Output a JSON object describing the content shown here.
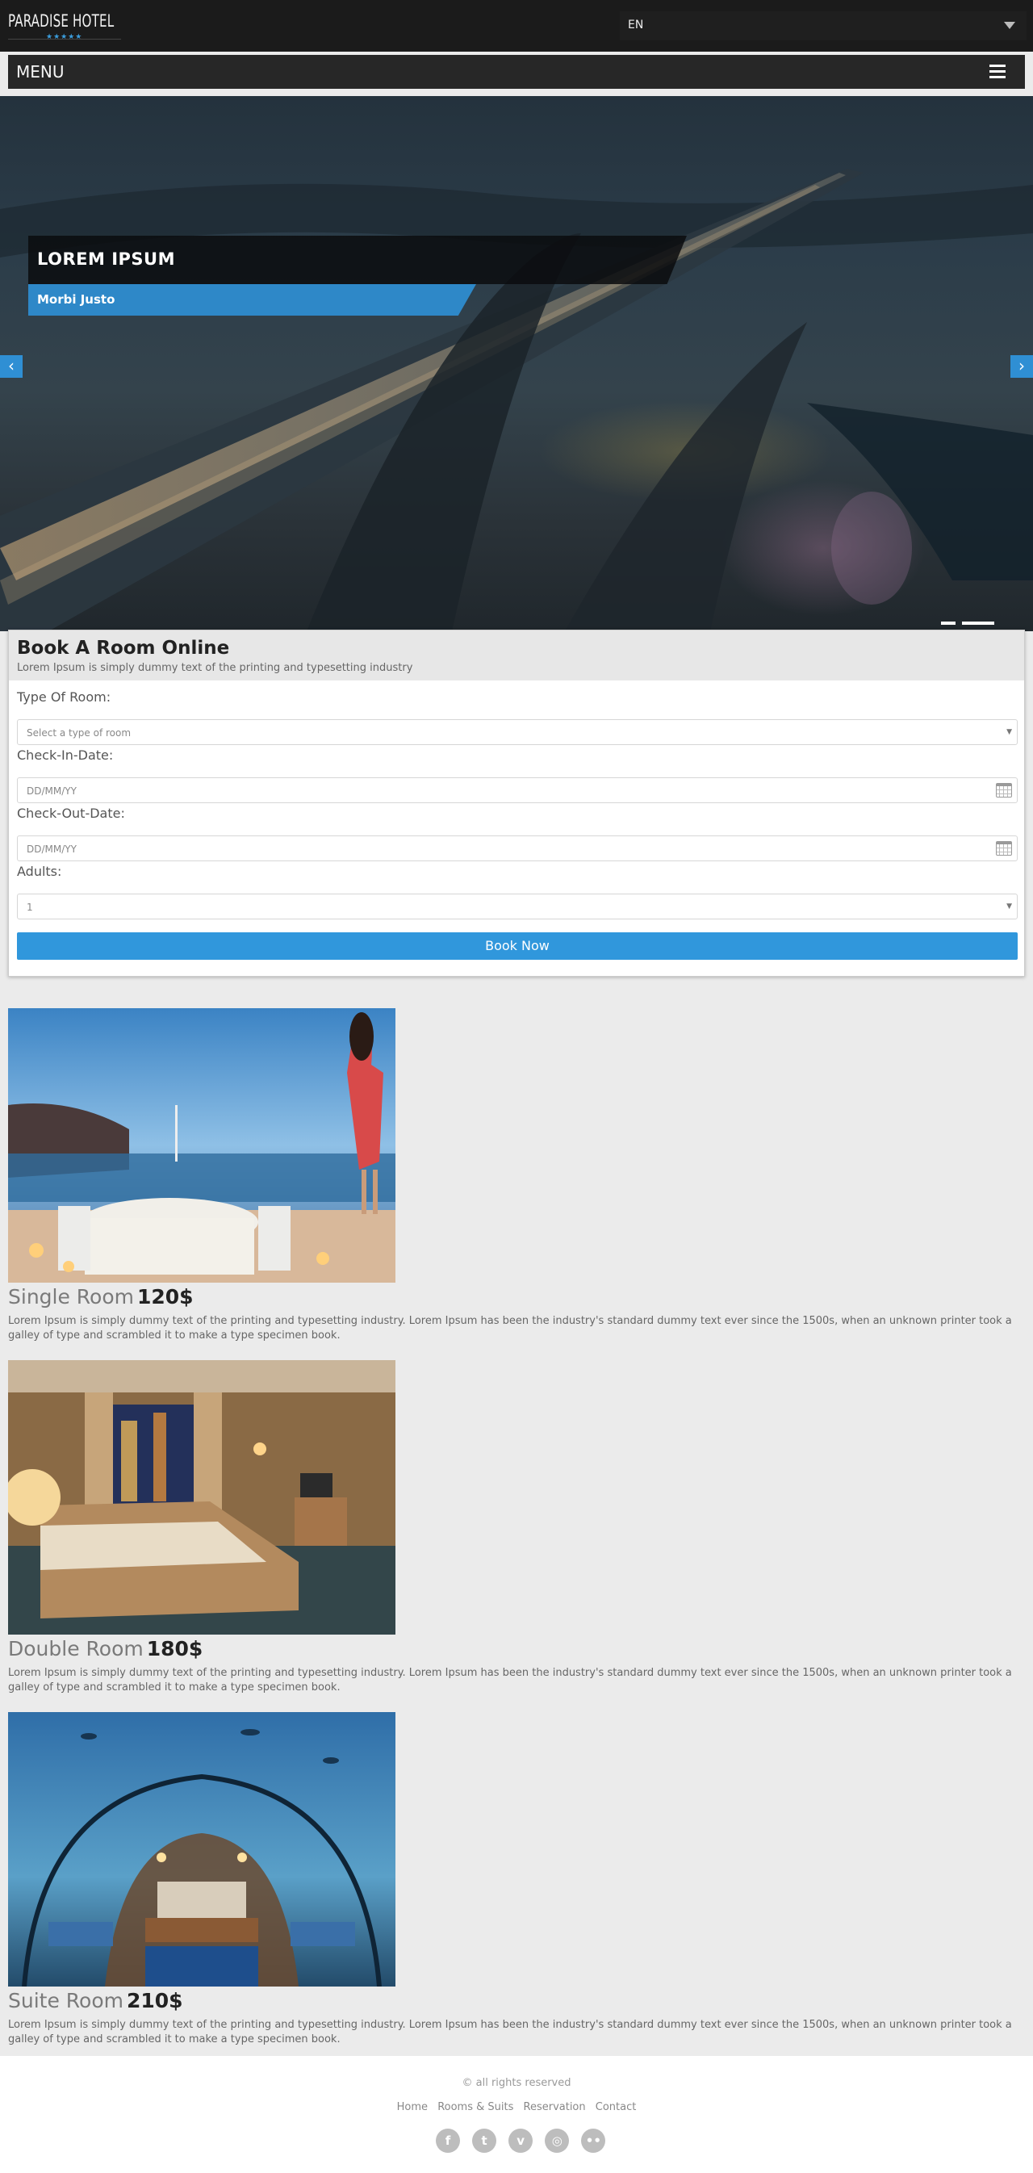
{
  "header": {
    "logo_text": "PARADISE HOTEL",
    "logo_stars": "★★★★★",
    "language": "EN"
  },
  "menu": {
    "label": "MENU"
  },
  "hero": {
    "title": "LOREM IPSUM",
    "subtitle": "Morbi Justo",
    "prev_arrow": "‹",
    "next_arrow": "›",
    "active_slide": 2,
    "slide_count": 2
  },
  "booking": {
    "title": "Book A Room Online",
    "subtitle": "Lorem Ipsum is simply dummy text of the printing and typesetting industry",
    "room_type_label": "Type Of Room:",
    "room_type_value": "Select a type of room",
    "checkin_label": "Check-In-Date:",
    "checkin_placeholder": "DD/MM/YY",
    "checkout_label": "Check-Out-Date:",
    "checkout_placeholder": "DD/MM/YY",
    "adults_label": "Adults:",
    "adults_value": "1",
    "button": "Book Now"
  },
  "rooms": [
    {
      "name": "Single Room",
      "price": "120$",
      "description": "Lorem Ipsum is simply dummy text of the printing and typesetting industry. Lorem Ipsum has been the industry's standard dummy text ever since the 1500s, when an unknown printer took a galley of type and scrambled it to make a type specimen book."
    },
    {
      "name": "Double Room",
      "price": "180$",
      "description": "Lorem Ipsum is simply dummy text of the printing and typesetting industry. Lorem Ipsum has been the industry's standard dummy text ever since the 1500s, when an unknown printer took a galley of type and scrambled it to make a type specimen book."
    },
    {
      "name": "Suite Room",
      "price": "210$",
      "description": "Lorem Ipsum is simply dummy text of the printing and typesetting industry. Lorem Ipsum has been the industry's standard dummy text ever since the 1500s, when an unknown printer took a galley of type and scrambled it to make a type specimen book."
    }
  ],
  "footer": {
    "copyright": "© all rights reserved",
    "nav": [
      "Home",
      "Rooms & Suits",
      "Reservation",
      "Contact"
    ],
    "social": [
      {
        "icon": "facebook-icon",
        "glyph": "f"
      },
      {
        "icon": "twitter-icon",
        "glyph": "t"
      },
      {
        "icon": "vimeo-icon",
        "glyph": "v"
      },
      {
        "icon": "dribbble-icon",
        "glyph": "◎"
      },
      {
        "icon": "flickr-icon",
        "glyph": "••"
      }
    ]
  },
  "colors": {
    "accent": "#3097dc",
    "topbar": "#1b1b1b",
    "background": "#ebebeb"
  }
}
